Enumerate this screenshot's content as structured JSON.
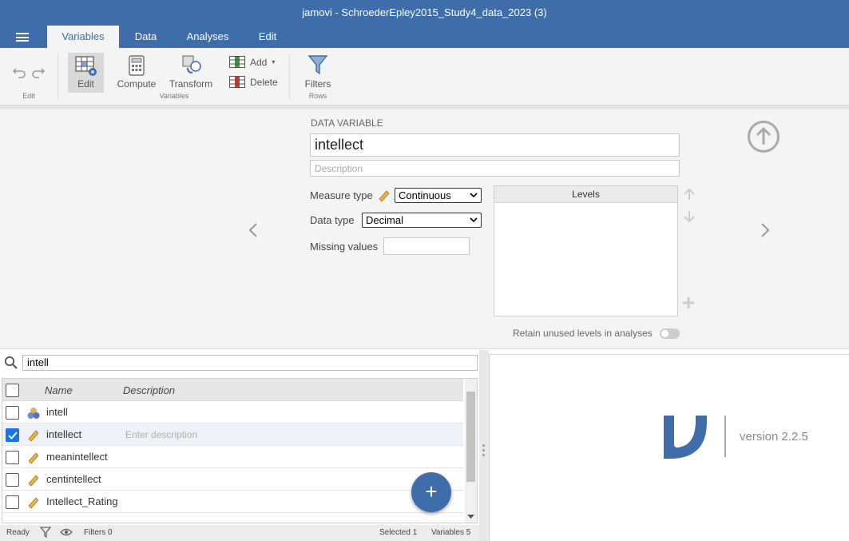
{
  "window": {
    "title": "jamovi - SchroederEpley2015_Study4_data_2023 (3)"
  },
  "tabs": [
    {
      "label": "Variables"
    },
    {
      "label": "Data"
    },
    {
      "label": "Analyses"
    },
    {
      "label": "Edit"
    }
  ],
  "ribbon": {
    "edit_group_label": "Edit",
    "edit_label": "Edit",
    "compute_label": "Compute",
    "transform_label": "Transform",
    "add_label": "Add",
    "delete_label": "Delete",
    "variables_group_label": "Variables",
    "filters_label": "Filters",
    "rows_group_label": "Rows"
  },
  "editor": {
    "section_title": "DATA VARIABLE",
    "name_value": "intellect",
    "description_placeholder": "Description",
    "measure_type_label": "Measure type",
    "measure_type_value": "Continuous",
    "data_type_label": "Data type",
    "data_type_value": "Decimal",
    "missing_values_label": "Missing values",
    "levels_header": "Levels",
    "retain_label": "Retain unused levels in analyses"
  },
  "search": {
    "value": "intell"
  },
  "table": {
    "col_name": "Name",
    "col_description": "Description",
    "description_placeholder": "Enter description",
    "rows": [
      {
        "name": "intell",
        "type": "nominal",
        "checked": false
      },
      {
        "name": "intellect",
        "type": "continuous",
        "checked": true
      },
      {
        "name": "meanintellect",
        "type": "continuous",
        "checked": false
      },
      {
        "name": "centintellect",
        "type": "continuous",
        "checked": false
      },
      {
        "name": "Intellect_Rating",
        "type": "continuous",
        "checked": false
      }
    ]
  },
  "status": {
    "ready": "Ready",
    "filters": "Filters 0",
    "selected": "Selected 1",
    "variables": "Variables 5"
  },
  "about": {
    "version": "version 2.2.5"
  },
  "colors": {
    "brand": "#3e6da9",
    "accent_check": "#1a73e8",
    "continuous_icon": "#e8b04a"
  }
}
